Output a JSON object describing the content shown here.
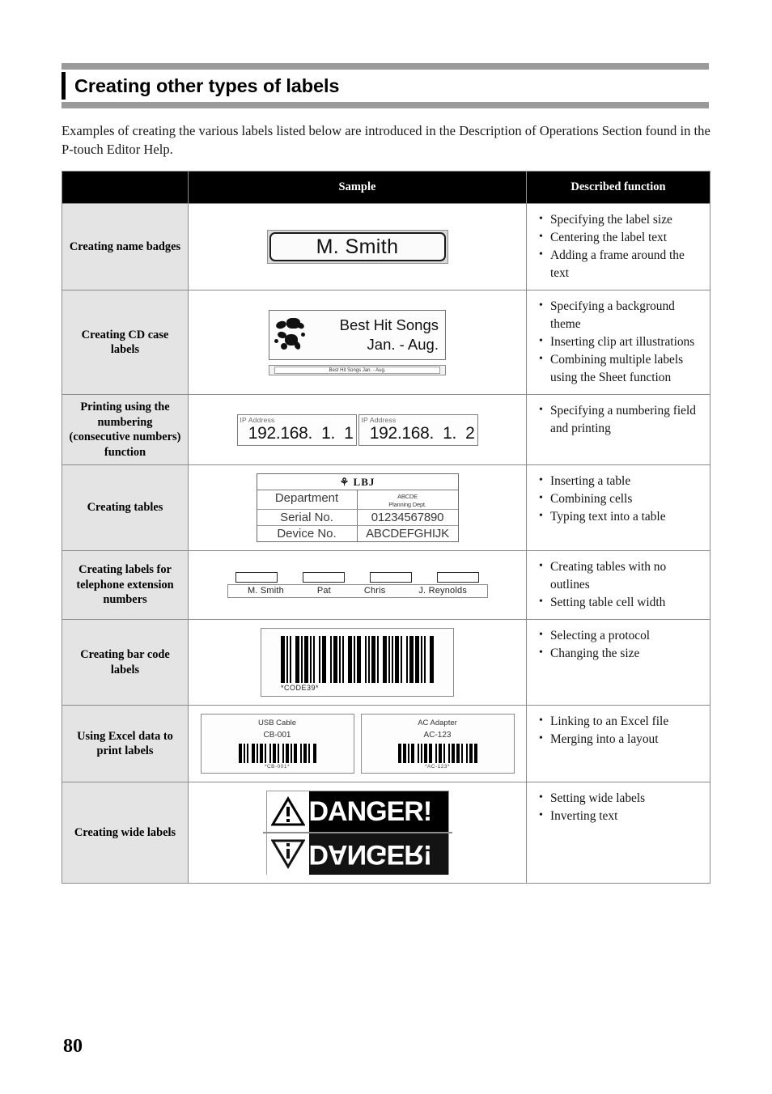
{
  "page": {
    "heading": "Creating other types of labels",
    "intro": "Examples of creating the various labels listed below are introduced in the Description of Operations Section found in the P-touch Editor Help.",
    "page_number": "80",
    "accent_rule_color": "#9a9a9a",
    "header_bg_color": "#000000",
    "category_bg_color": "#e4e4e4"
  },
  "table": {
    "headers": {
      "category": "",
      "sample": "Sample",
      "function": "Described function"
    },
    "rows": [
      {
        "category": "Creating name badges",
        "functions": [
          "Specifying the label size",
          "Centering the label text",
          "Adding a frame around the text"
        ],
        "sample": {
          "kind": "name-badge",
          "text": "M. Smith"
        }
      },
      {
        "category": "Creating CD case labels",
        "functions": [
          "Specifying a background theme",
          "Inserting clip art illustrations",
          "Combining multiple labels using the Sheet function"
        ],
        "sample": {
          "kind": "cd-case",
          "line1": "Best Hit Songs",
          "line2": "Jan. - Aug.",
          "spine": "Best Hit Songs Jan. - Aug."
        }
      },
      {
        "category": "Printing using the numbering (consecutive numbers) function",
        "functions": [
          "Specifying a numbering field and printing"
        ],
        "sample": {
          "kind": "ip-address",
          "caption": "IP Address",
          "value1": "192.168.  1.  1",
          "value2": "192.168.  1.  2"
        }
      },
      {
        "category": "Creating tables",
        "functions": [
          "Inserting a table",
          "Combining cells",
          "Typing text into a table"
        ],
        "sample": {
          "kind": "dept-table",
          "logo": "⚘ LBJ",
          "rows": [
            {
              "key": "Department",
              "value": "ABCDE\nPlanning Dept."
            },
            {
              "key": "Serial No.",
              "value": "01234567890"
            },
            {
              "key": "Device No.",
              "value": "ABCDEFGHIJK"
            }
          ]
        }
      },
      {
        "category": "Creating labels for telephone extension numbers",
        "functions": [
          "Creating tables with no outlines",
          "Setting table cell width"
        ],
        "sample": {
          "kind": "phone-ext",
          "names": [
            "M. Smith",
            "Pat",
            "Chris",
            "J. Reynolds"
          ]
        }
      },
      {
        "category": "Creating bar code labels",
        "functions": [
          "Selecting a protocol",
          "Changing the size"
        ],
        "sample": {
          "kind": "barcode",
          "caption": "*CODE39*"
        }
      },
      {
        "category": "Using Excel data to print labels",
        "functions": [
          "Linking to an Excel file",
          "Merging into a layout"
        ],
        "sample": {
          "kind": "excel-labels",
          "labels": [
            {
              "title": "USB Cable",
              "code": "CB-001",
              "caption": "*CB-001*"
            },
            {
              "title": "AC Adapter",
              "code": "AC-123",
              "caption": "*AC-123*"
            }
          ]
        }
      },
      {
        "category": "Creating wide labels",
        "functions": [
          "Setting wide labels",
          "Inverting text"
        ],
        "sample": {
          "kind": "danger",
          "text": "DANGER!"
        }
      }
    ]
  }
}
